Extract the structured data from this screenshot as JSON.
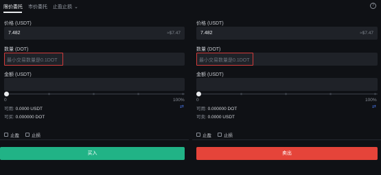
{
  "tabs": [
    {
      "label": "限价委托"
    },
    {
      "label": "市价委托"
    },
    {
      "label": "止盈止损"
    }
  ],
  "buy": {
    "price_label": "价格 (USDT)",
    "price_value": "7.482",
    "price_approx": "≈$7.47",
    "qty_label": "数量 (DOT)",
    "qty_placeholder": "最小交易数量是0.1DOT",
    "amount_label": "金额 (USDT)",
    "slider_min": "0",
    "slider_max": "100%",
    "avail_label": "可用:",
    "avail_value": "0.0000 USDT",
    "can_label": "可买:",
    "can_value": "0.000000 DOT",
    "tp_label": "止盈",
    "sl_label": "止损",
    "button_label": "买入"
  },
  "sell": {
    "price_label": "价格 (USDT)",
    "price_value": "7.482",
    "price_approx": "≈$7.47",
    "qty_label": "数量 (DOT)",
    "qty_placeholder": "最小交易数量是0.1DOT",
    "amount_label": "金额 (USDT)",
    "slider_min": "0",
    "slider_max": "100%",
    "avail_label": "可用:",
    "avail_value": "0.000000 DOT",
    "can_label": "可卖:",
    "can_value": "0.0000 USDT",
    "tp_label": "止盈",
    "sl_label": "止损",
    "button_label": "卖出"
  },
  "colors": {
    "buy": "#21b386",
    "sell": "#e5443a",
    "highlight": "#d43c3c"
  }
}
